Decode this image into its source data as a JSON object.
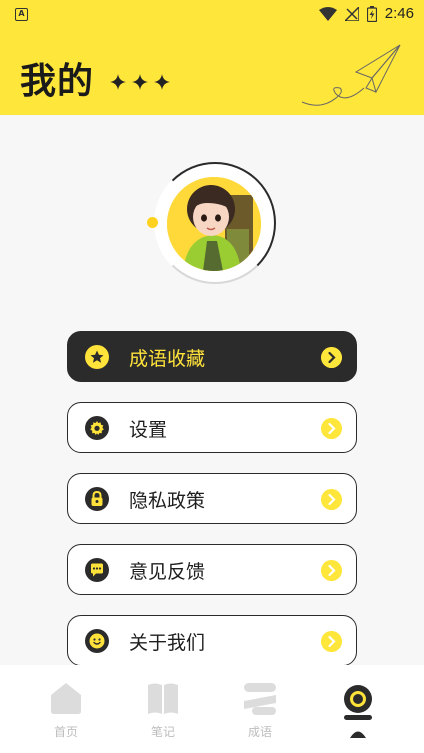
{
  "status_bar": {
    "time": "2:46",
    "app_badge": "A"
  },
  "header": {
    "title": "我的"
  },
  "menu": {
    "items": [
      {
        "label": "成语收藏",
        "icon": "star-icon",
        "active": true
      },
      {
        "label": "设置",
        "icon": "gear-icon",
        "active": false
      },
      {
        "label": "隐私政策",
        "icon": "lock-icon",
        "active": false
      },
      {
        "label": "意见反馈",
        "icon": "chat-bubble-icon",
        "active": false
      },
      {
        "label": "关于我们",
        "icon": "smiley-icon",
        "active": false
      }
    ]
  },
  "tabbar": {
    "tabs": [
      {
        "label": "首页",
        "icon": "home-icon"
      },
      {
        "label": "笔记",
        "icon": "book-icon"
      },
      {
        "label": "成语",
        "icon": "idiom-icon"
      },
      {
        "label": "",
        "icon": "profile-icon",
        "selected": true
      }
    ]
  },
  "colors": {
    "accent": "#ffe63a",
    "dark": "#2b2b2b",
    "background": "#f7f7f7"
  }
}
